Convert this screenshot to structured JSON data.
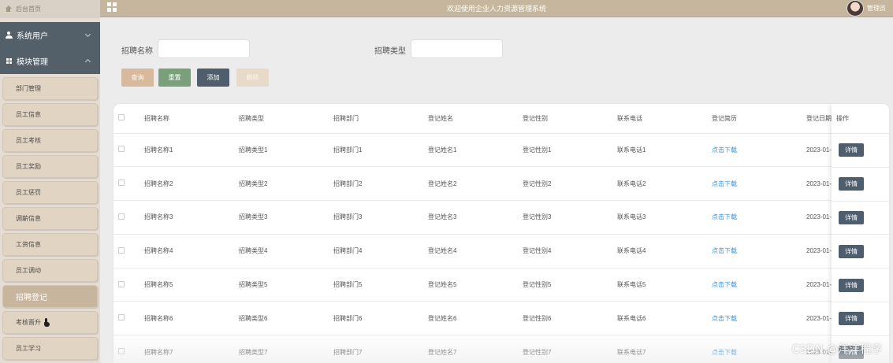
{
  "sidebar": {
    "home_label": "后台首页",
    "groups": [
      {
        "label": "系统用户",
        "icon": "user-icon"
      },
      {
        "label": "模块管理",
        "icon": "grid-icon"
      }
    ],
    "items": [
      {
        "label": "部门管理"
      },
      {
        "label": "员工信息"
      },
      {
        "label": "员工考核"
      },
      {
        "label": "员工奖励"
      },
      {
        "label": "员工惩罚"
      },
      {
        "label": "调薪信息"
      },
      {
        "label": "工资信息"
      },
      {
        "label": "员工调动"
      },
      {
        "label": "招聘登记"
      },
      {
        "label": "考核晋升"
      },
      {
        "label": "员工学习"
      }
    ]
  },
  "header": {
    "title": "欢迎使用企业人力资源管理系统",
    "user": "管理员"
  },
  "search": {
    "name_label": "招聘名称",
    "name_value": "",
    "type_label": "招聘类型",
    "type_value": ""
  },
  "buttons": {
    "query": "查询",
    "reset": "重置",
    "add": "添加",
    "delete": "删除"
  },
  "table": {
    "columns": [
      "招聘名称",
      "招聘类型",
      "招聘部门",
      "登记姓名",
      "登记性别",
      "联系电话",
      "登记简历",
      "登记日期"
    ],
    "op_label": "操作",
    "detail_label": "详情",
    "rows": [
      [
        "招聘名称1",
        "招聘类型1",
        "招聘部门1",
        "登记姓名1",
        "登记性别1",
        "联系电话1",
        "点击下载",
        "2023-01-"
      ],
      [
        "招聘名称2",
        "招聘类型2",
        "招聘部门2",
        "登记姓名2",
        "登记性别2",
        "联系电话2",
        "点击下载",
        "2023-01-"
      ],
      [
        "招聘名称3",
        "招聘类型3",
        "招聘部门3",
        "登记姓名3",
        "登记性别3",
        "联系电话3",
        "点击下载",
        "2023-01-"
      ],
      [
        "招聘名称4",
        "招聘类型4",
        "招聘部门4",
        "登记姓名4",
        "登记性别4",
        "联系电话4",
        "点击下载",
        "2023-01-"
      ],
      [
        "招聘名称5",
        "招聘类型5",
        "招聘部门5",
        "登记姓名5",
        "登记性别5",
        "联系电话5",
        "点击下载",
        "2023-01-"
      ],
      [
        "招聘名称6",
        "招聘类型6",
        "招聘部门6",
        "登记姓名6",
        "登记性别6",
        "联系电话6",
        "点击下载",
        "2023-01-"
      ],
      [
        "招聘名称7",
        "招聘类型7",
        "招聘部门7",
        "登记姓名7",
        "登记性别7",
        "联系电话7",
        "点击下载",
        "2023-01-"
      ]
    ]
  },
  "watermark": "CSDN @洋洋程序",
  "colors": {
    "header_bg": "#c6b69d",
    "sidebar_group_bg": "#535f69",
    "menu_item_bg": "#e2d4c2",
    "menu_active_bg": "#c8b59d",
    "btn_query": "#d7b99c",
    "btn_reset": "#7aa07b",
    "btn_add": "#505d6c",
    "btn_delete": "#e8dac9",
    "link": "#3e90d6"
  }
}
